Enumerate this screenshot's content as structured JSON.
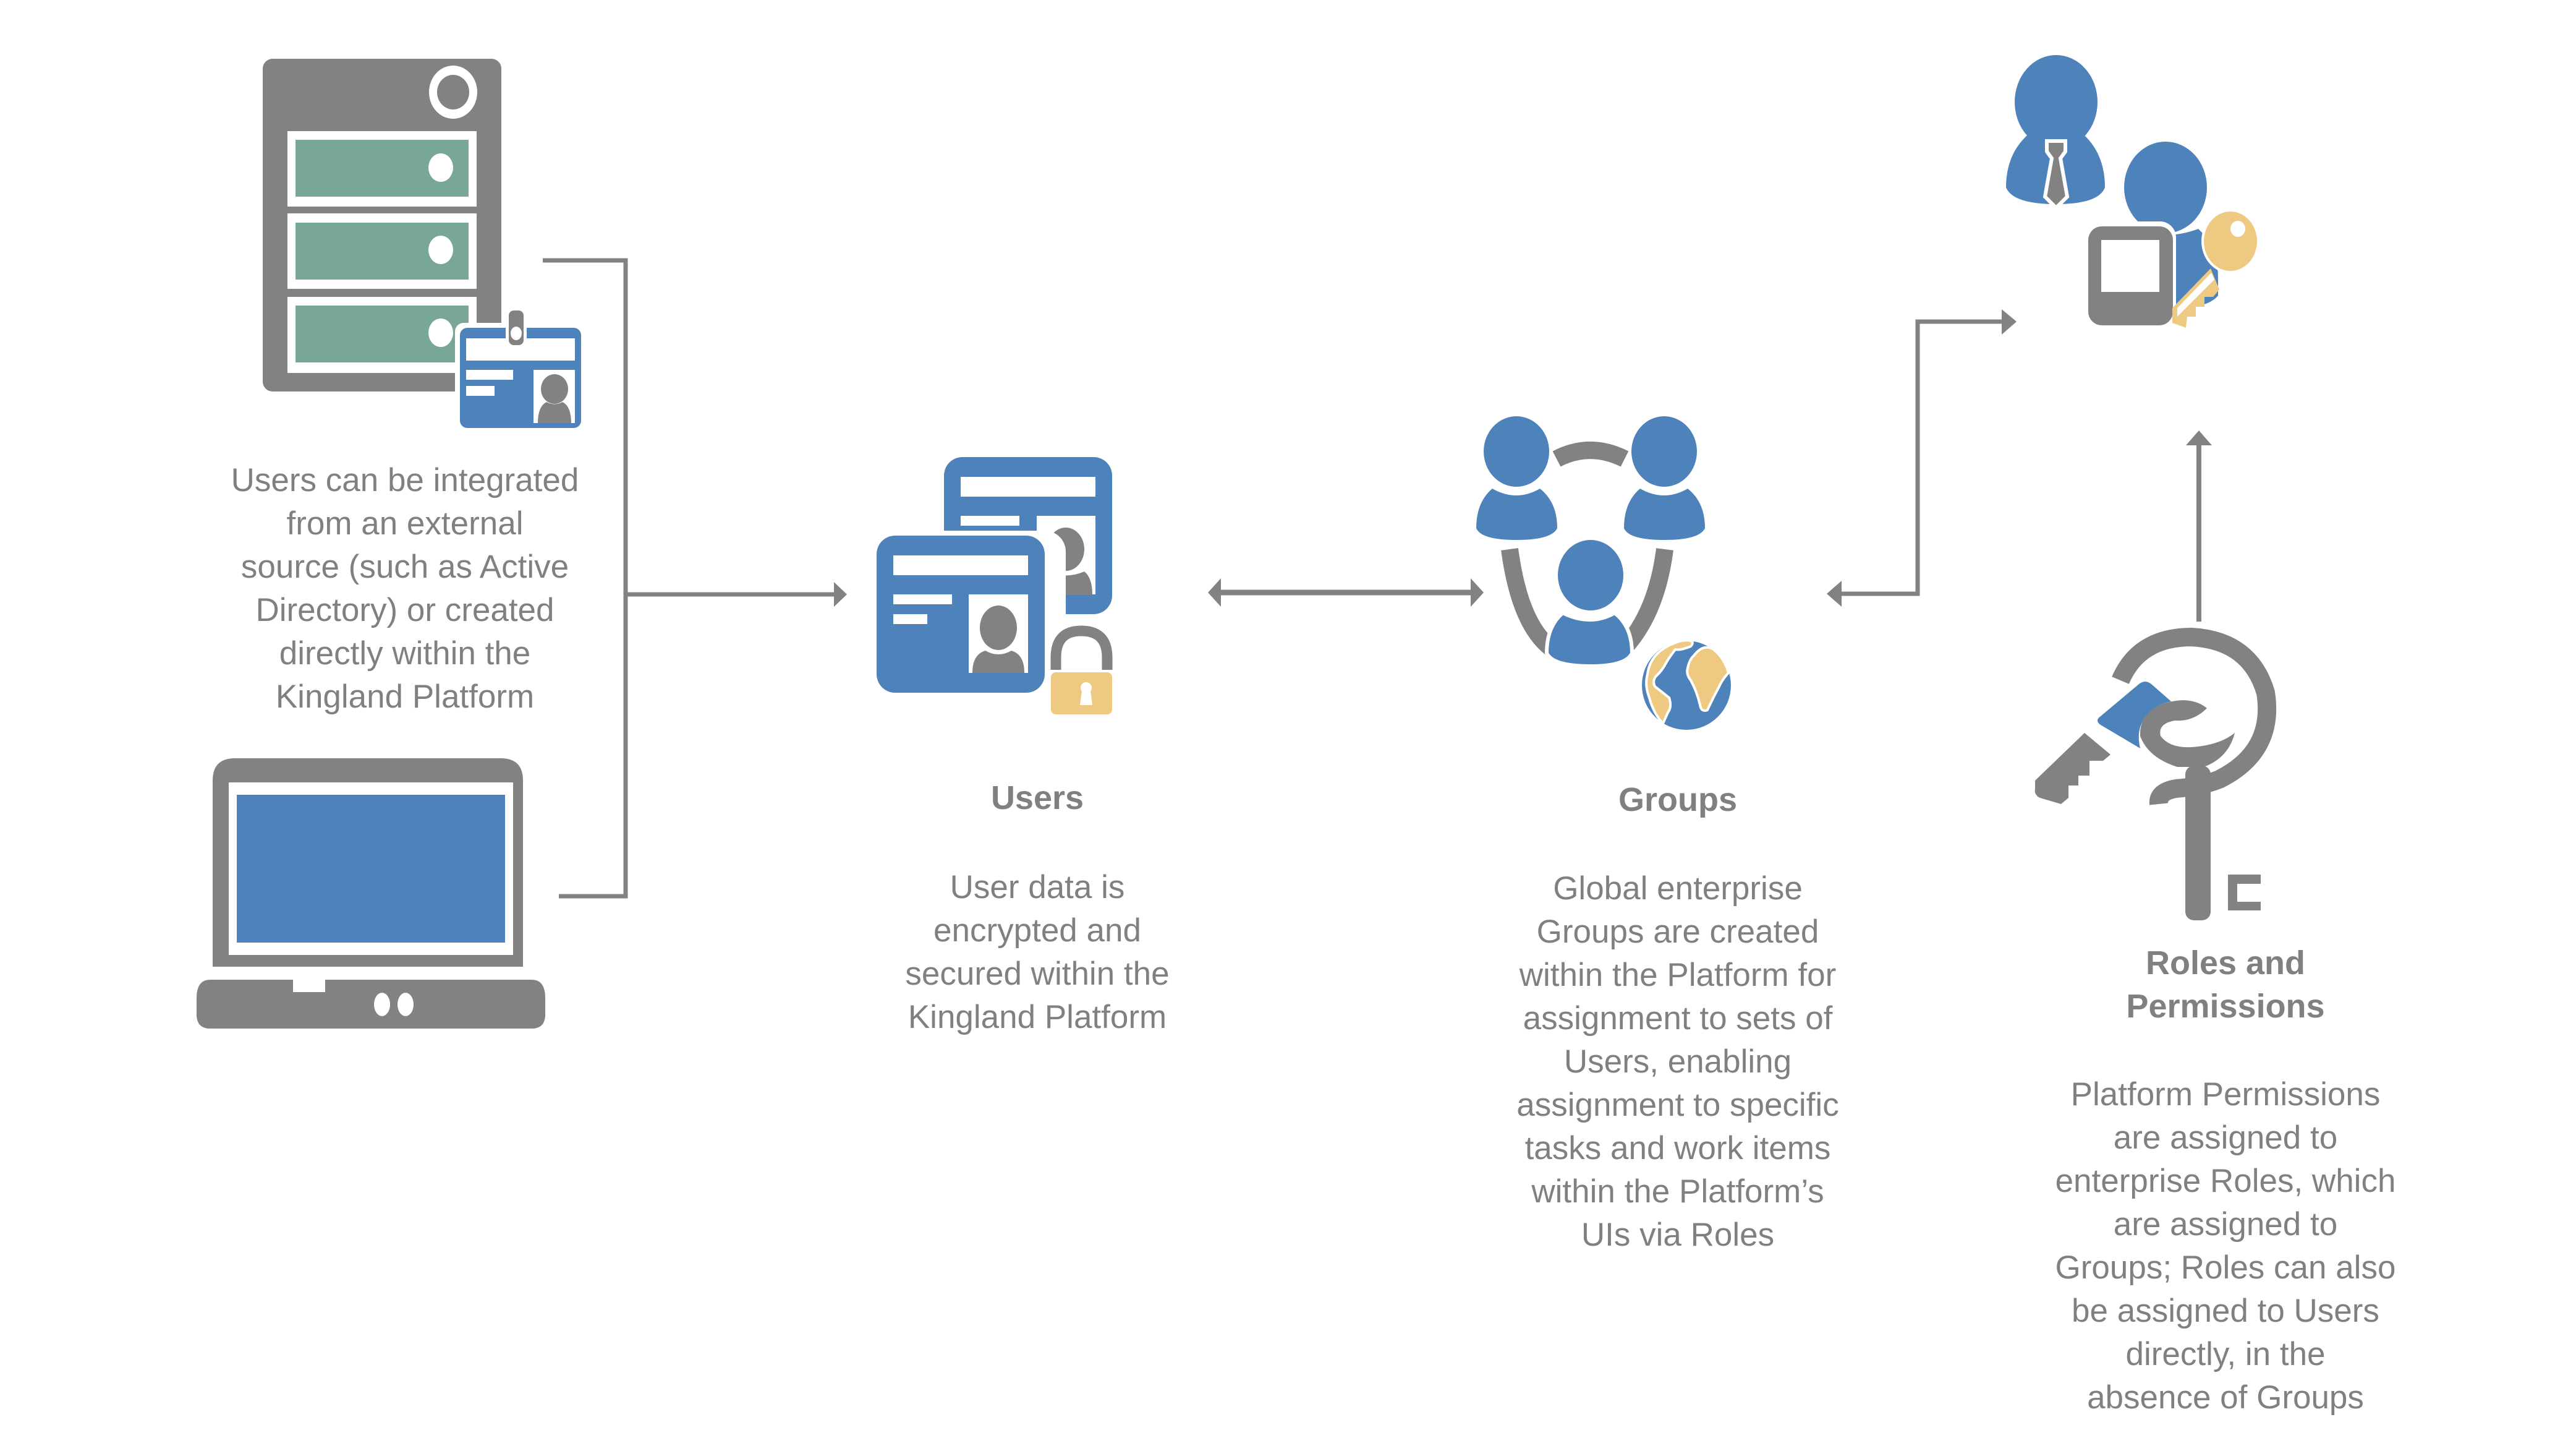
{
  "colors": {
    "gray": "#818281",
    "blue": "#4e82bb",
    "teal": "#78a698",
    "gold": "#eec982",
    "white": "#ffffff",
    "text": "#7f8180"
  },
  "source": {
    "description_lines": [
      "Users can be integrated",
      "from an external",
      "source (such as Active",
      "Directory) or created",
      "directly within the",
      "Kingland Platform"
    ],
    "icons": [
      "server-icon",
      "id-badge-icon",
      "laptop-icon"
    ]
  },
  "users": {
    "title": "Users",
    "description_lines": [
      "User data is",
      "encrypted and",
      "secured within the",
      "Kingland Platform"
    ],
    "icons": [
      "id-cards-icon",
      "padlock-icon"
    ]
  },
  "groups": {
    "title": "Groups",
    "description_lines": [
      "Global enterprise",
      "Groups are created",
      "within the Platform for",
      "assignment to sets of",
      "Users, enabling",
      "assignment to specific",
      "tasks and work items",
      "within the Platform’s",
      "UIs via Roles"
    ],
    "icons": [
      "group-cycle-icon",
      "globe-icon"
    ]
  },
  "roles": {
    "title_lines": [
      "Roles and",
      "Permissions"
    ],
    "description_lines": [
      "Platform Permissions",
      "are assigned to",
      "enterprise Roles, which",
      "are assigned to",
      "Groups; Roles can also",
      "be assigned to Users",
      "directly, in the",
      "absence of Groups"
    ],
    "icons": [
      "keyring-icon"
    ]
  },
  "admin": {
    "icons": [
      "business-user-icon",
      "user-icon",
      "monitor-icon",
      "key-icon"
    ]
  },
  "connectors": [
    {
      "from": "source",
      "to": "users",
      "direction": "one-way"
    },
    {
      "from": "users",
      "to": "groups",
      "direction": "two-way"
    },
    {
      "from": "groups",
      "to": "admin",
      "direction": "two-way"
    },
    {
      "from": "roles",
      "to": "admin",
      "direction": "one-way"
    }
  ]
}
